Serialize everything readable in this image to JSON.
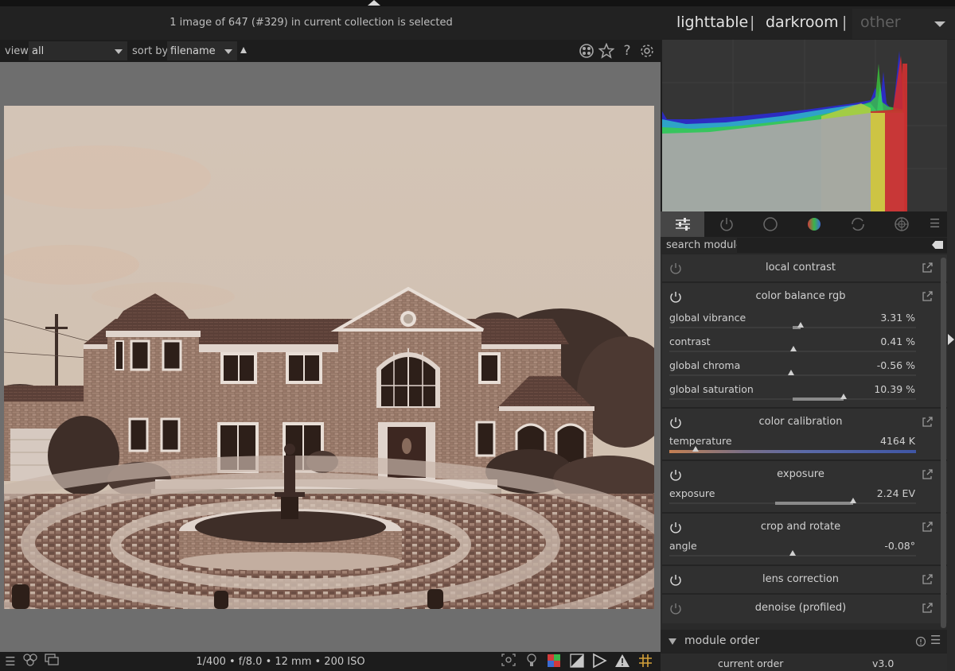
{
  "header": {
    "status": "1 image of 647 (#329) in current collection is selected"
  },
  "views": {
    "lighttable": "lighttable",
    "separator": "|",
    "darkroom": "darkroom",
    "other": "other"
  },
  "filterbar": {
    "view_label": "view",
    "view_value": "all",
    "sort_label": "sort by",
    "sort_value": "filename",
    "icons": [
      "group-icon",
      "star-icon",
      "help-icon",
      "settings-icon"
    ]
  },
  "bottombar": {
    "exif": "1/400 • f/8.0 • 12 mm • 200 ISO",
    "left_icons": [
      "menu-icon",
      "styles-icon",
      "second-window-icon"
    ],
    "right_icons": [
      "focus-peaking-icon",
      "raw-overexposed-icon",
      "color-assessment-icon",
      "softproof-icon",
      "gamut-check-icon",
      "clipping-warning-icon",
      "guides-icon"
    ]
  },
  "tabs": [
    "quick-access-tab",
    "active-modules-tab",
    "base-tab",
    "tone-tab",
    "color-tab",
    "correct-tab",
    "effects-tab"
  ],
  "search": {
    "label": "search module",
    "value": ""
  },
  "modules": [
    {
      "name": "local contrast",
      "enabled": false,
      "sliders": []
    },
    {
      "name": "color balance rgb",
      "enabled": true,
      "sliders": [
        {
          "label": "global vibrance",
          "value": "3.31 %"
        },
        {
          "label": "contrast",
          "value": "0.41 %"
        },
        {
          "label": "global chroma",
          "value": "-0.56 %"
        },
        {
          "label": "global saturation",
          "value": "10.39 %"
        }
      ]
    },
    {
      "name": "color calibration",
      "enabled": true,
      "sliders": [
        {
          "label": "temperature",
          "value": "4164 K"
        }
      ]
    },
    {
      "name": "exposure",
      "enabled": true,
      "sliders": [
        {
          "label": "exposure",
          "value": "2.24 EV"
        }
      ]
    },
    {
      "name": "crop and rotate",
      "enabled": true,
      "sliders": [
        {
          "label": "angle",
          "value": "-0.08°"
        }
      ]
    },
    {
      "name": "lens correction",
      "enabled": true,
      "sliders": []
    },
    {
      "name": "denoise (profiled)",
      "enabled": false,
      "sliders": []
    }
  ],
  "module_order": {
    "title": "module order",
    "current_label": "current order",
    "current_value": "v3.0"
  },
  "colors": {
    "accent_temperature": "#3f56a6",
    "photo_tone": "sepia"
  }
}
